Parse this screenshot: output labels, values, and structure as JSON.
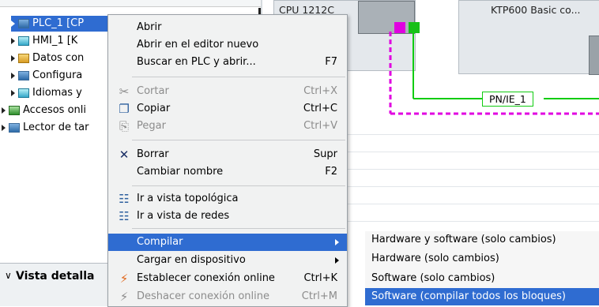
{
  "tree": {
    "items": [
      {
        "label": "PLC_1 [CP",
        "icon": "plc-icon"
      },
      {
        "label": "HMI_1 [K",
        "icon": "hmi-icon"
      },
      {
        "label": "Datos con",
        "icon": "data-folder-icon"
      },
      {
        "label": "Configura",
        "icon": "config-icon"
      },
      {
        "label": "Idiomas y",
        "icon": "languages-icon"
      },
      {
        "label": "Accesos onli",
        "icon": "online-access-icon"
      },
      {
        "label": "Lector de tar",
        "icon": "card-reader-icon"
      }
    ],
    "detail_label": "Vista detalla"
  },
  "network": {
    "cpu_label": "CPU 1212C",
    "hmi_label": "KTP600 Basic co...",
    "subnet_label": "PN/IE_1"
  },
  "context_menu": {
    "items": [
      {
        "label": "Abrir",
        "shortcut": "",
        "icon": "",
        "disabled": false
      },
      {
        "label": "Abrir en el editor nuevo",
        "shortcut": "",
        "icon": "",
        "disabled": false
      },
      {
        "label": "Buscar en PLC y abrir...",
        "shortcut": "F7",
        "icon": "",
        "disabled": false
      },
      {
        "label": "Cortar",
        "shortcut": "Ctrl+X",
        "icon": "scissors-icon",
        "disabled": true
      },
      {
        "label": "Copiar",
        "shortcut": "Ctrl+C",
        "icon": "copy-icon",
        "disabled": false
      },
      {
        "label": "Pegar",
        "shortcut": "Ctrl+V",
        "icon": "paste-icon",
        "disabled": true
      },
      {
        "label": "Borrar",
        "shortcut": "Supr",
        "icon": "delete-x-icon",
        "disabled": false
      },
      {
        "label": "Cambiar nombre",
        "shortcut": "F2",
        "icon": "",
        "disabled": false
      },
      {
        "label": "Ir a vista topológica",
        "shortcut": "",
        "icon": "topology-view-icon",
        "disabled": false
      },
      {
        "label": "Ir a vista de redes",
        "shortcut": "",
        "icon": "network-view-icon",
        "disabled": false
      },
      {
        "label": "Compilar",
        "shortcut": "",
        "icon": "",
        "disabled": false,
        "submenu": true,
        "highlighted": true
      },
      {
        "label": "Cargar en dispositivo",
        "shortcut": "",
        "icon": "",
        "disabled": false,
        "submenu": true
      },
      {
        "label": "Establecer conexión online",
        "shortcut": "Ctrl+K",
        "icon": "go-online-icon",
        "disabled": false
      },
      {
        "label": "Deshacer conexión online",
        "shortcut": "Ctrl+M",
        "icon": "go-offline-icon",
        "disabled": true
      }
    ]
  },
  "compile_submenu": {
    "items": [
      {
        "label": "Hardware y software (solo cambios)"
      },
      {
        "label": "Hardware (solo cambios)"
      },
      {
        "label": "Software (solo cambios)"
      },
      {
        "label": "Software (compilar todos los bloques)",
        "highlighted": true
      }
    ]
  },
  "colors": {
    "selection": "#2f6cd1",
    "profinet": "#1c1",
    "mpi": "#e000e0"
  }
}
